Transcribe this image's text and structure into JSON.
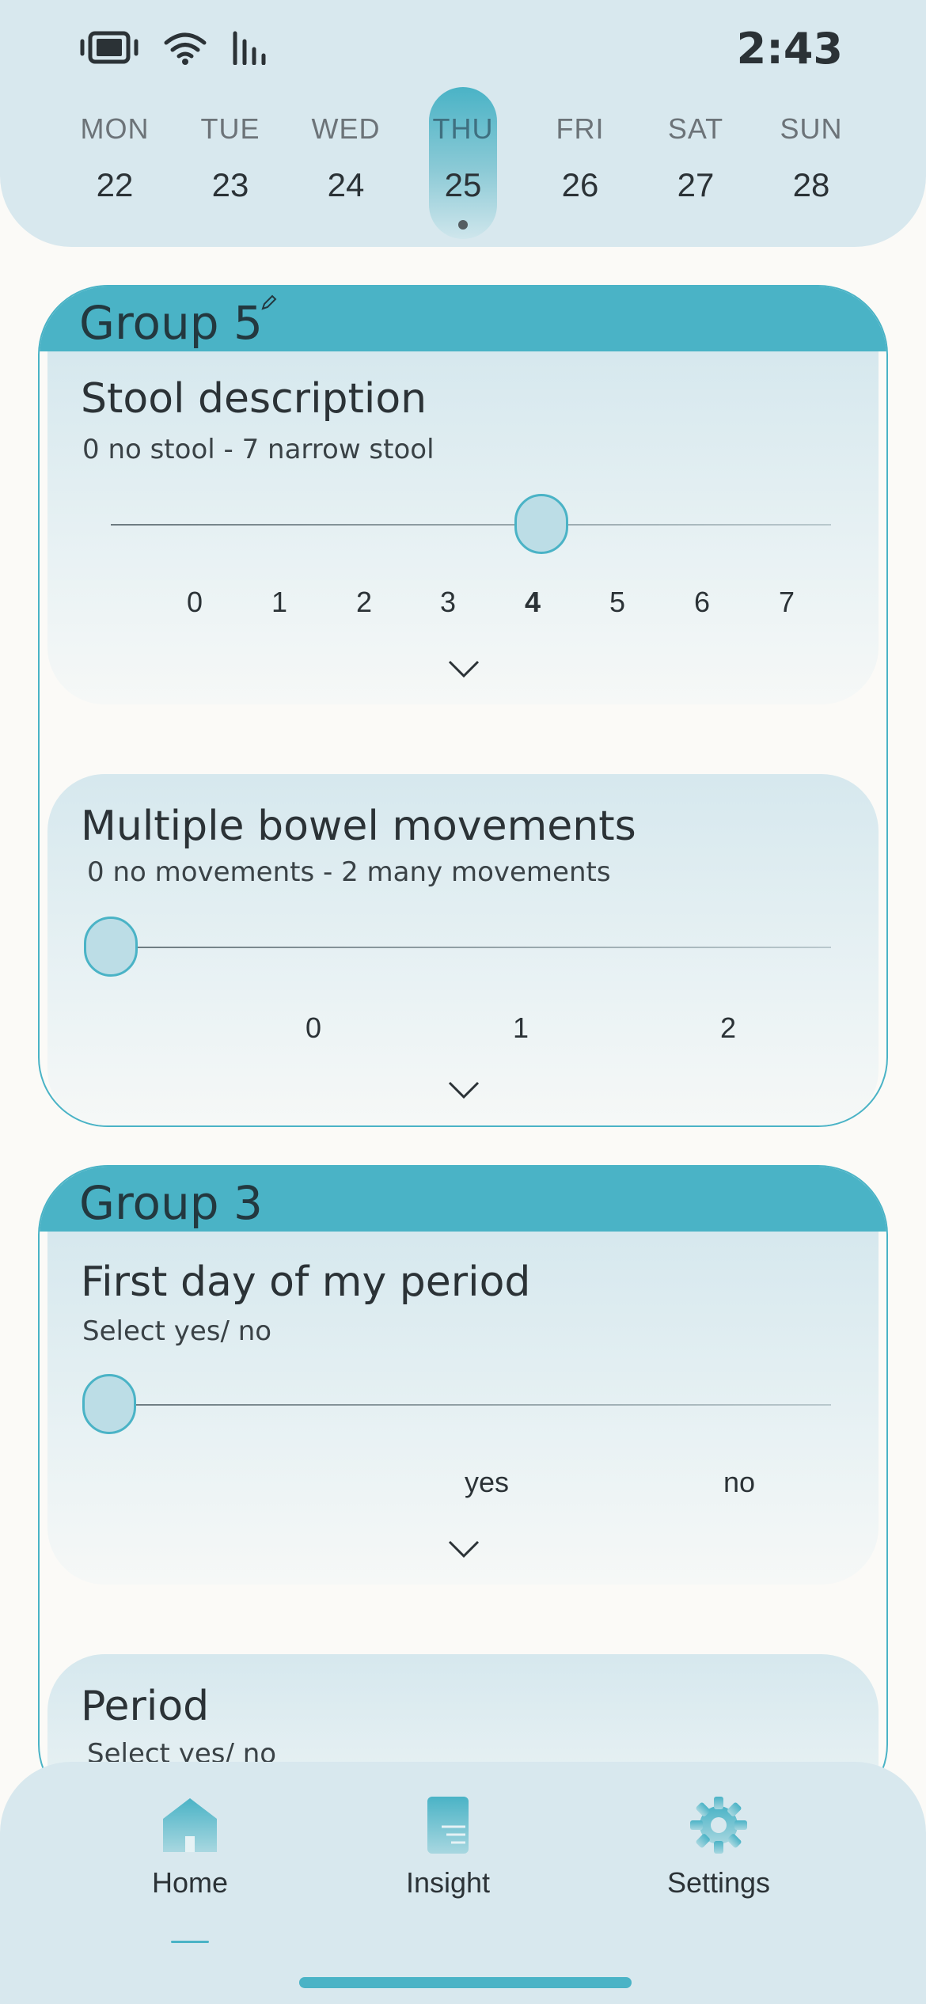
{
  "status": {
    "time": "2:43"
  },
  "week": {
    "days": [
      {
        "name": "MON",
        "num": "22"
      },
      {
        "name": "TUE",
        "num": "23"
      },
      {
        "name": "WED",
        "num": "24"
      },
      {
        "name": "THU",
        "num": "25"
      },
      {
        "name": "FRI",
        "num": "26"
      },
      {
        "name": "SAT",
        "num": "27"
      },
      {
        "name": "SUN",
        "num": "28"
      }
    ],
    "today_index": 0,
    "selected_index": 3
  },
  "groups": [
    {
      "title": "Group 5",
      "cards": [
        {
          "title": "Stool description",
          "subtitle": "0 no stool - 7 narrow stool",
          "ticks": [
            "0",
            "1",
            "2",
            "3",
            "4",
            "5",
            "6",
            "7"
          ],
          "value": "4"
        },
        {
          "title": "Multiple bowel movements",
          "subtitle": "0 no movements - 2 many movements",
          "ticks": [
            "0",
            "1",
            "2"
          ],
          "value": "none"
        }
      ]
    },
    {
      "title": "Group 3",
      "cards": [
        {
          "title": "First day of my period",
          "subtitle": "Select yes/ no",
          "ticks": [
            "yes",
            "no"
          ],
          "value": "none"
        },
        {
          "title": "Period",
          "subtitle": "Select yes/ no"
        }
      ]
    }
  ],
  "nav": {
    "items": [
      {
        "label": "Home",
        "icon": "home-icon",
        "active": true
      },
      {
        "label": "Insight",
        "icon": "insight-icon",
        "active": false
      },
      {
        "label": "Settings",
        "icon": "gear-icon",
        "active": false
      }
    ]
  },
  "colors": {
    "accent": "#4ab3c6",
    "header_bg": "#d8e8ee",
    "today_highlight": "#e8b8bb",
    "page_bg": "#fbfaf7"
  }
}
